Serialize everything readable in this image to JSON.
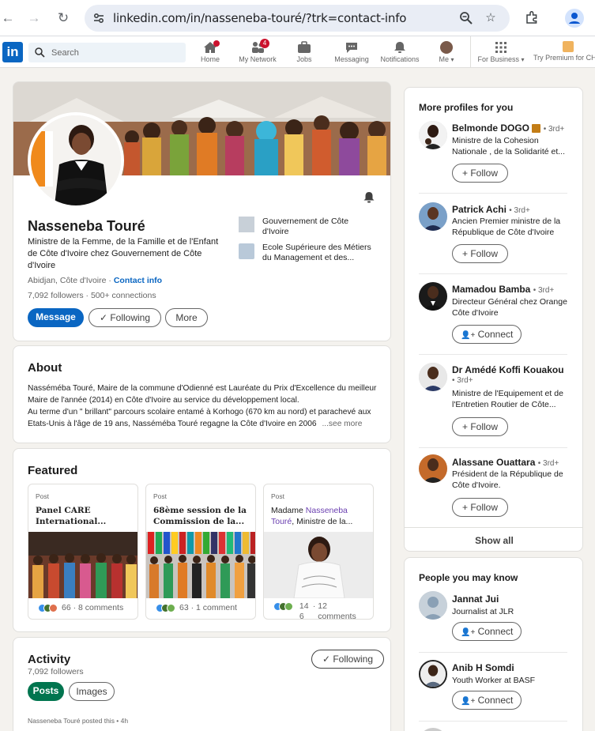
{
  "browser": {
    "url": "linkedin.com/in/nasseneba-touré/?trk=contact-info"
  },
  "nav": {
    "search_placeholder": "Search",
    "items": [
      {
        "label": "Home",
        "badge": "",
        "icon": "home-icon"
      },
      {
        "label": "My Network",
        "badge": "4",
        "icon": "network-icon"
      },
      {
        "label": "Jobs",
        "badge": "",
        "icon": "jobs-icon"
      },
      {
        "label": "Messaging",
        "badge": "",
        "icon": "messaging-icon"
      },
      {
        "label": "Notifications",
        "badge": "",
        "icon": "bell-icon"
      },
      {
        "label": "Me",
        "badge": "",
        "icon": "me-avatar"
      }
    ],
    "for_business": "For Business",
    "premium": "Try Premium for CH"
  },
  "profile": {
    "name": "Nasseneba Touré",
    "headline": "Ministre de la Femme, de la Famille et de l'Enfant de Côte d'Ivoire chez Gouvernement de Côte d'Ivoire",
    "location": "Abidjan, Côte d'Ivoire",
    "contact_info": "Contact info",
    "followers": "7,092 followers",
    "connections": "500+ connections",
    "btn_message": "Message",
    "btn_following": "Following",
    "btn_more": "More",
    "org1": "Gouvernement de Côte d'Ivoire",
    "org2": "Ecole Supérieure des Métiers du Management et des..."
  },
  "about": {
    "title": "About",
    "text1": "Nasséméba Touré, Maire de la commune d'Odienné est Lauréate du Prix d'Excellence du meilleur Maire de l'année (2014) en Côte d'Ivoire au service du développement local.",
    "text2": "Au terme d'un \" brillant\" parcours scolaire entamé à Korhogo (670 km au nord) et parachevé aux Etats-Unis à l'âge de 19 ans, Nasséméba Touré regagne la Côte d'Ivoire en 2006",
    "see_more": "...see more"
  },
  "featured": {
    "title": "Featured",
    "items": [
      {
        "label": "Post",
        "title": "Panel CARE International...",
        "count": "66",
        "comments": "8 comments"
      },
      {
        "label": "Post",
        "title": "68ème session de la Commission de la...",
        "count": "63",
        "comments": "1 comment"
      },
      {
        "label": "Post",
        "title_pre": "Madame ",
        "title_link": "Nasseneba Touré",
        "title_post": ", Ministre de la...",
        "count": "14 6",
        "comments": "12 comments"
      }
    ]
  },
  "activity": {
    "title": "Activity",
    "followers": "7,092 followers",
    "btn_following": "Following",
    "tab_posts": "Posts",
    "tab_images": "Images",
    "posted": "Nasseneba Touré posted this • 4h"
  },
  "more_profiles": {
    "title": "More profiles for you",
    "show_all": "Show all",
    "items": [
      {
        "name": "Belmonde DOGO",
        "degree": "• 3rd+",
        "desc": "Ministre de la Cohesion Nationale , de la Solidarité et...",
        "action": "Follow"
      },
      {
        "name": "Patrick Achi",
        "degree": "• 3rd+",
        "desc": "Ancien Premier ministre de la République de Côte d'Ivoire",
        "action": "Follow"
      },
      {
        "name": "Mamadou Bamba",
        "degree": "• 3rd+",
        "desc": "Directeur Général chez Orange Côte d'Ivoire",
        "action": "Connect"
      },
      {
        "name": "Dr Amédé Koffi Kouakou",
        "degree": "• 3rd+",
        "desc": "Ministre de l'Equipement et de l'Entretien Routier de Côte...",
        "action": "Follow"
      },
      {
        "name": "Alassane Ouattara",
        "degree": "• 3rd+",
        "desc": "Président de la République de Côte d'Ivoire.",
        "action": "Follow"
      }
    ]
  },
  "people_know": {
    "title": "People you may know",
    "items": [
      {
        "name": "Jannat Jui",
        "desc": "Journalist at JLR",
        "action": "Connect"
      },
      {
        "name": "Anib H Somdi",
        "desc": "Youth Worker at BASF",
        "action": "Connect"
      }
    ]
  },
  "colors": {
    "brand": "#0a66c2",
    "green": "#01754f",
    "bg": "#f4f2ee"
  }
}
